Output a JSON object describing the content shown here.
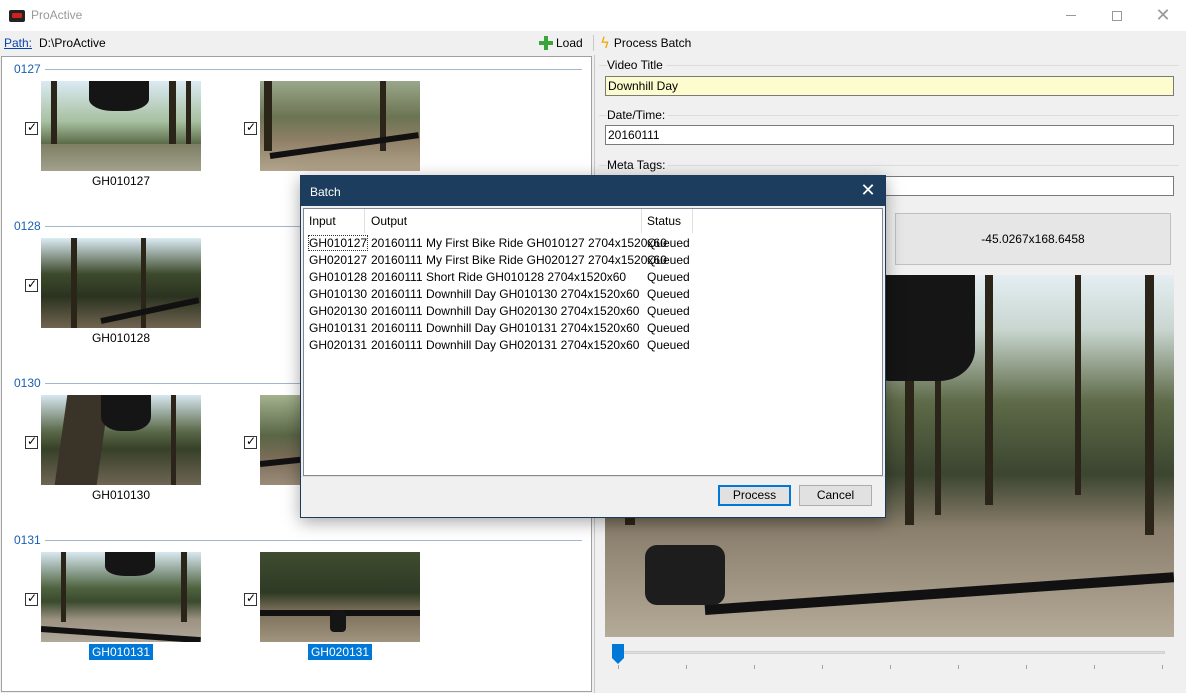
{
  "window": {
    "title": "ProActive",
    "controls": [
      "minimize",
      "maximize",
      "close"
    ]
  },
  "toolbar": {
    "path_label": "Path:",
    "path_value": "D:\\ProActive",
    "load_label": "Load",
    "process_batch_label": "Process Batch"
  },
  "groups": [
    {
      "title": "0127",
      "items": [
        {
          "name": "GH010127",
          "checked": true,
          "selected": false
        },
        {
          "name": "",
          "checked": true,
          "selected": false
        }
      ]
    },
    {
      "title": "0128",
      "items": [
        {
          "name": "GH010128",
          "checked": true,
          "selected": false
        }
      ]
    },
    {
      "title": "0130",
      "items": [
        {
          "name": "GH010130",
          "checked": true,
          "selected": false
        },
        {
          "name": "",
          "checked": true,
          "selected": false
        }
      ]
    },
    {
      "title": "0131",
      "items": [
        {
          "name": "GH010131",
          "checked": true,
          "selected": true
        },
        {
          "name": "GH020131",
          "checked": true,
          "selected": true
        }
      ]
    }
  ],
  "details": {
    "video_title_label": "Video Title",
    "video_title_value": "Downhill Day",
    "datetime_label": "Date/Time:",
    "datetime_value": "20160111",
    "meta_tags_label": "Meta Tags:",
    "meta_tags_value": "",
    "coords": "-45.0267x168.6458"
  },
  "slider": {
    "value": 0
  },
  "dialog": {
    "title": "Batch",
    "columns": [
      "Input",
      "Output",
      "Status"
    ],
    "rows": [
      {
        "input": "GH010127",
        "output": "20160111 My First Bike Ride GH010127 2704x1520x60",
        "status": "Queued"
      },
      {
        "input": "GH020127",
        "output": "20160111 My First Bike Ride GH020127 2704x1520x60",
        "status": "Queued"
      },
      {
        "input": "GH010128",
        "output": "20160111 Short Ride GH010128 2704x1520x60",
        "status": "Queued"
      },
      {
        "input": "GH010130",
        "output": "20160111 Downhill Day GH010130 2704x1520x60",
        "status": "Queued"
      },
      {
        "input": "GH020130",
        "output": "20160111 Downhill Day GH020130 2704x1520x60",
        "status": "Queued"
      },
      {
        "input": "GH010131",
        "output": "20160111 Downhill Day GH010131 2704x1520x60",
        "status": "Queued"
      },
      {
        "input": "GH020131",
        "output": "20160111 Downhill Day GH020131 2704x1520x60",
        "status": "Queued"
      }
    ],
    "process_label": "Process",
    "cancel_label": "Cancel"
  },
  "colors": {
    "accent": "#0078d7",
    "dialog_titlebar": "#1c3d5e",
    "group_title": "#1a5fb4",
    "title_input_bg": "#fcfccf"
  }
}
